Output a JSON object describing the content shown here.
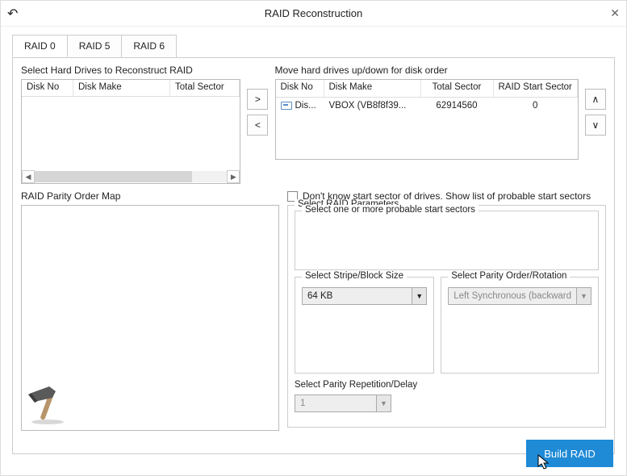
{
  "title": "RAID Reconstruction",
  "tabs": [
    "RAID 0",
    "RAID 5",
    "RAID 6"
  ],
  "activeTab": 0,
  "left": {
    "label": "Select Hard Drives to Reconstruct RAID",
    "cols": [
      "Disk No",
      "Disk Make",
      "Total Sector"
    ]
  },
  "right": {
    "label": "Move hard drives up/down for disk order",
    "cols": [
      "Disk No",
      "Disk Make",
      "Total Sector",
      "RAID Start Sector"
    ],
    "rows": [
      {
        "diskno": "Dis...",
        "make": "VBOX (VB8f8f39...",
        "total": "62914560",
        "start": "0"
      }
    ]
  },
  "chk": {
    "label": "Don't know start sector of drives. Show list of probable start sectors"
  },
  "parityMapLabel": "RAID Parity Order Map",
  "params": {
    "groupLabel": "Select RAID Parameters",
    "startSectorsLabel": "Select one or more probable start sectors",
    "stripeLabel": "Select Stripe/Block Size",
    "stripeValue": "64 KB",
    "parityOrderLabel": "Select Parity Order/Rotation",
    "parityOrderValue": "Left Synchronous (backward",
    "repLabel": "Select Parity Repetition/Delay",
    "repValue": "1"
  },
  "buildLabel": "Build RAID"
}
